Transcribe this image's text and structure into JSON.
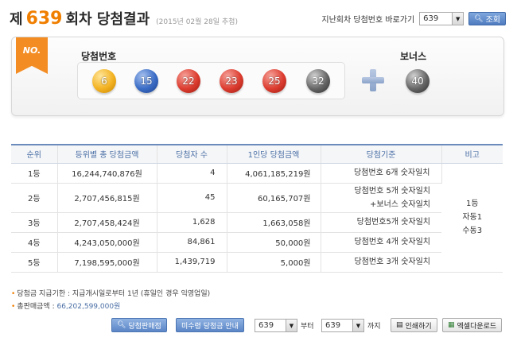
{
  "header": {
    "title_prefix": "제",
    "round": "639",
    "title_suffix": "회차 당첨결과",
    "draw_date": "(2015년 02월 28일 추첨)",
    "goto_label": "지난회차 당첨번호 바로가기",
    "goto_select_value": "639",
    "search_button": "조회"
  },
  "result": {
    "no_badge": "NO.",
    "win_label": "당첨번호",
    "bonus_label": "보너스",
    "numbers": [
      {
        "value": "6",
        "color": "yellow"
      },
      {
        "value": "15",
        "color": "blue"
      },
      {
        "value": "22",
        "color": "red"
      },
      {
        "value": "23",
        "color": "red"
      },
      {
        "value": "25",
        "color": "red"
      },
      {
        "value": "32",
        "color": "gray"
      }
    ],
    "bonus": {
      "value": "40",
      "color": "gray"
    }
  },
  "table": {
    "headers": [
      "순위",
      "등위별 총 당첨금액",
      "당첨자 수",
      "1인당 당첨금액",
      "당첨기준",
      "비고"
    ],
    "rows": [
      {
        "rank": "1등",
        "total": "16,244,740,876원",
        "winners": "4",
        "per": "4,061,185,219원",
        "criteria": [
          "당첨번호 6개 숫자일치"
        ]
      },
      {
        "rank": "2등",
        "total": "2,707,456,815원",
        "winners": "45",
        "per": "60,165,707원",
        "criteria": [
          "당첨번호 5개 숫자일치",
          "+보너스 숫자일치"
        ]
      },
      {
        "rank": "3등",
        "total": "2,707,458,424원",
        "winners": "1,628",
        "per": "1,663,058원",
        "criteria": [
          "당첨번호5개 숫자일치"
        ]
      },
      {
        "rank": "4등",
        "total": "4,243,050,000원",
        "winners": "84,861",
        "per": "50,000원",
        "criteria": [
          "당첨번호 4개 숫자일치"
        ]
      },
      {
        "rank": "5등",
        "total": "7,198,595,000원",
        "winners": "1,439,719",
        "per": "5,000원",
        "criteria": [
          "당첨번호 3개 숫자일치"
        ]
      }
    ],
    "note_lines": [
      "1등",
      "자동1",
      "수동3"
    ]
  },
  "notes": {
    "deadline": "당첨금 지급기한 : 지급개시일로부터 1년 (휴일인 경우 익영업일)",
    "total_sales_label": "총판매금액 :",
    "total_sales_value": "66,202,599,000원"
  },
  "bottom": {
    "shop_button": "당첨판매점",
    "unclaimed_button": "미수령 당첨금 안내",
    "from_value": "639",
    "from_label": "부터",
    "to_value": "639",
    "to_label": "까지",
    "print_button": "인쇄하기",
    "excel_button": "엑셀다운로드"
  },
  "colors": {
    "accent": "#f07f00",
    "table_header": "#4a6fa5"
  }
}
